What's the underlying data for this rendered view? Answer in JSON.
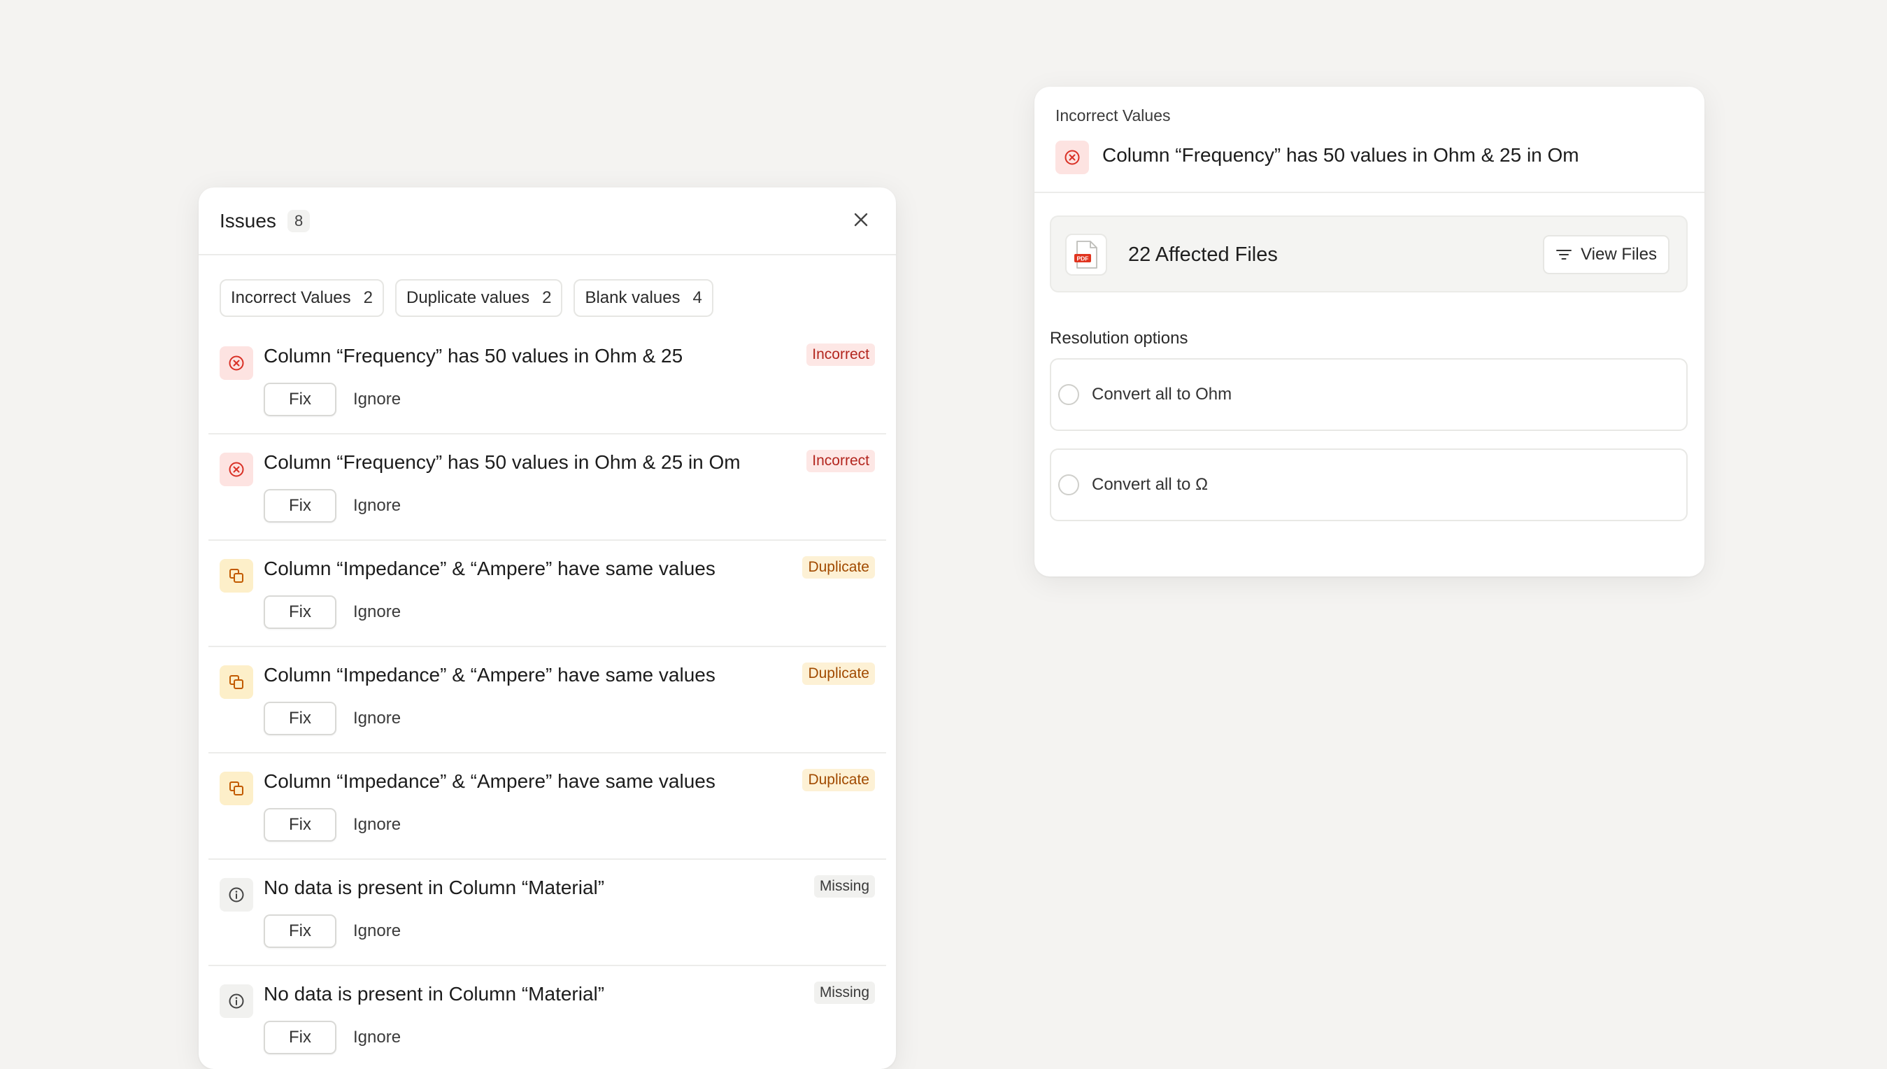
{
  "issues_panel": {
    "title": "Issues",
    "count": "8",
    "filters": [
      {
        "label": "Incorrect Values",
        "count": "2"
      },
      {
        "label": "Duplicate values",
        "count": "2"
      },
      {
        "label": "Blank values",
        "count": "4"
      }
    ],
    "items": [
      {
        "type": "incorrect",
        "icon": "x-circle-icon",
        "text": "Column “Frequency” has 50 values in Ohm & 25",
        "badge": "Incorrect",
        "fix_label": "Fix",
        "ignore_label": "Ignore"
      },
      {
        "type": "incorrect",
        "icon": "x-circle-icon",
        "text": "Column “Frequency” has 50 values in Ohm & 25 in Om",
        "badge": "Incorrect",
        "fix_label": "Fix",
        "ignore_label": "Ignore"
      },
      {
        "type": "duplicate",
        "icon": "copy-icon",
        "text": "Column “Impedance” &  “Ampere” have same values",
        "badge": "Duplicate",
        "fix_label": "Fix",
        "ignore_label": "Ignore"
      },
      {
        "type": "duplicate",
        "icon": "copy-icon",
        "text": "Column “Impedance” &  “Ampere” have same values",
        "badge": "Duplicate",
        "fix_label": "Fix",
        "ignore_label": "Ignore"
      },
      {
        "type": "duplicate",
        "icon": "copy-icon",
        "text": "Column “Impedance” &  “Ampere” have same values",
        "badge": "Duplicate",
        "fix_label": "Fix",
        "ignore_label": "Ignore"
      },
      {
        "type": "missing",
        "icon": "info-icon",
        "text": "No data is present in Column “Material”",
        "badge": "Missing",
        "fix_label": "Fix",
        "ignore_label": "Ignore"
      },
      {
        "type": "missing",
        "icon": "info-icon",
        "text": "No data is present in Column “Material”",
        "badge": "Missing",
        "fix_label": "Fix",
        "ignore_label": "Ignore"
      }
    ]
  },
  "detail_panel": {
    "category": "Incorrect Values",
    "title": "Column “Frequency” has 50 values in Ohm & 25 in Om",
    "files": {
      "icon_text": "PDF",
      "label": "22 Affected Files",
      "view_label": "View Files"
    },
    "resolution": {
      "title": "Resolution options",
      "options": [
        "Convert all to Ohm",
        "Convert all to Ω"
      ]
    }
  },
  "colors": {
    "background": "#f4f3f1",
    "incorrect": "#d93025",
    "duplicate": "#c25a00",
    "missing": "#555555"
  }
}
